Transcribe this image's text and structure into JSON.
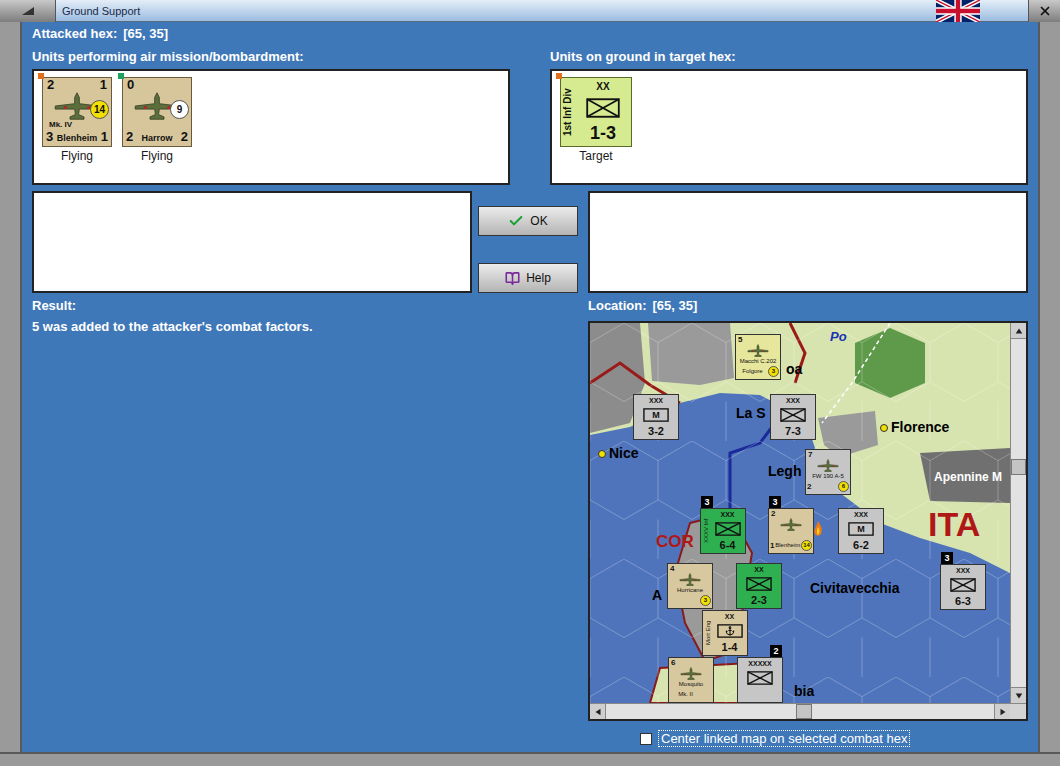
{
  "window": {
    "title": "Ground Support"
  },
  "attacked_hex": {
    "label": "Attacked hex:",
    "value": "[65, 35]"
  },
  "air_panel": {
    "label": "Units performing air mission/bombardment:",
    "units": [
      {
        "name": "Blenheim",
        "model": "Mk. IV",
        "top_left": "2",
        "top_right": "1",
        "bottom_left": "3",
        "bottom_right": "1",
        "range": "14",
        "range_color": "#f2e000",
        "marker_color": "#e07020",
        "status": "Flying"
      },
      {
        "name": "Harrow",
        "model": "",
        "top_left": "0",
        "top_right": "",
        "bottom_left": "2",
        "bottom_right": "2",
        "range": "9",
        "range_color": "#ffffff",
        "marker_color": "#20a060",
        "status": "Flying"
      }
    ]
  },
  "ground_panel": {
    "label": "Units on ground in target hex:",
    "units": [
      {
        "name": "1st Inf Div",
        "size": "XX",
        "strength": "1-3",
        "status": "Target",
        "marker_color": "#e07020",
        "color": "#d6eb8f"
      }
    ]
  },
  "buttons": [
    {
      "label": "OK"
    },
    {
      "label": "Help"
    }
  ],
  "result": {
    "label": "Result:",
    "text": "5 was added to the attacker's combat factors."
  },
  "location": {
    "label": "Location:",
    "value": "[65, 35]"
  },
  "map": {
    "places": [
      {
        "name": "Po",
        "kind": "river",
        "dot": false
      },
      {
        "name": "oa",
        "kind": "city",
        "dot": false
      },
      {
        "name": "La S",
        "kind": "city",
        "dot": false
      },
      {
        "name": "Nice",
        "kind": "city",
        "dot": true
      },
      {
        "name": "Florence",
        "kind": "city",
        "dot": true
      },
      {
        "name": "Legh",
        "kind": "city",
        "dot": false
      },
      {
        "name": "Apennine M",
        "kind": "terrain",
        "dot": false
      },
      {
        "name": "ITA",
        "kind": "region",
        "dot": false
      },
      {
        "name": "COR",
        "kind": "island",
        "dot": false
      },
      {
        "name": "A",
        "kind": "city",
        "dot": false
      },
      {
        "name": "Civitavecchia",
        "kind": "city",
        "dot": false
      },
      {
        "name": "bia",
        "kind": "city",
        "dot": false
      }
    ],
    "counters": [
      {
        "kind": "air",
        "top_left": "5",
        "top_right": "",
        "name": "Macchi C.202",
        "bottom_left": "",
        "bottom": "Folgore",
        "range": "3",
        "range_color": "#f2e000",
        "color": "#e6e69c",
        "badge": "",
        "attacking": false
      },
      {
        "kind": "land",
        "size": "XXX",
        "symbol": "M",
        "strength": "3-2",
        "side": "",
        "color": "#c6c6c6",
        "badge": "",
        "marine": false
      },
      {
        "kind": "land",
        "size": "XXX",
        "symbol": "",
        "strength": "7-3",
        "side": "",
        "color": "#c6c6c6",
        "badge": "",
        "marine": false
      },
      {
        "kind": "air",
        "top_left": "7",
        "top_right": "",
        "name": "FW 190 A-5",
        "bottom_left": "2",
        "bottom": "",
        "range": "6",
        "range_color": "#f2e000",
        "color": "#c6c6c6",
        "badge": "",
        "attacking": false
      },
      {
        "kind": "land",
        "size": "XXX",
        "symbol": "",
        "strength": "6-4",
        "side": "XXXV Inf",
        "color": "#2fb050",
        "badge": "3",
        "marine": false
      },
      {
        "kind": "air",
        "top_left": "2",
        "top_right": "",
        "name": "",
        "bottom_left": "1",
        "bottom": "Blenheim",
        "range": "14",
        "range_color": "#f2e000",
        "color": "#d8c8a0",
        "badge": "3",
        "attacking": true
      },
      {
        "kind": "land",
        "size": "XXX",
        "symbol": "M",
        "strength": "6-2",
        "side": "",
        "color": "#c6c6c6",
        "badge": "",
        "marine": false
      },
      {
        "kind": "land",
        "size": "XXX",
        "symbol": "",
        "strength": "6-3",
        "side": "",
        "color": "#c6c6c6",
        "badge": "3",
        "marine": false
      },
      {
        "kind": "air",
        "top_left": "4",
        "top_right": "",
        "name": "Hurricane",
        "bottom_left": "",
        "bottom": "",
        "range": "3",
        "range_color": "#f2e000",
        "color": "#d8c8a0",
        "badge": "",
        "attacking": false
      },
      {
        "kind": "land",
        "size": "XX",
        "symbol": "",
        "strength": "2-3",
        "side": "",
        "color": "#2fb050",
        "badge": "",
        "marine": false
      },
      {
        "kind": "land",
        "size": "XX",
        "symbol": "",
        "strength": "1-4",
        "side": "Mort Eng",
        "color": "#d8c8a0",
        "badge": "",
        "marine": true
      },
      {
        "kind": "air",
        "top_left": "6",
        "top_right": "",
        "name": "Mosquito",
        "bottom_left": "",
        "bottom": "Mk. II",
        "range": "",
        "range_color": "#f2e000",
        "color": "#d8c8a0",
        "badge": "",
        "attacking": false
      },
      {
        "kind": "land",
        "size": "XXXXX",
        "symbol": "",
        "strength": "",
        "side": "",
        "color": "#c6c6c6",
        "badge": "2",
        "marine": false
      }
    ]
  },
  "checkbox": {
    "label": "Center linked map on selected combat hex",
    "checked": false
  }
}
